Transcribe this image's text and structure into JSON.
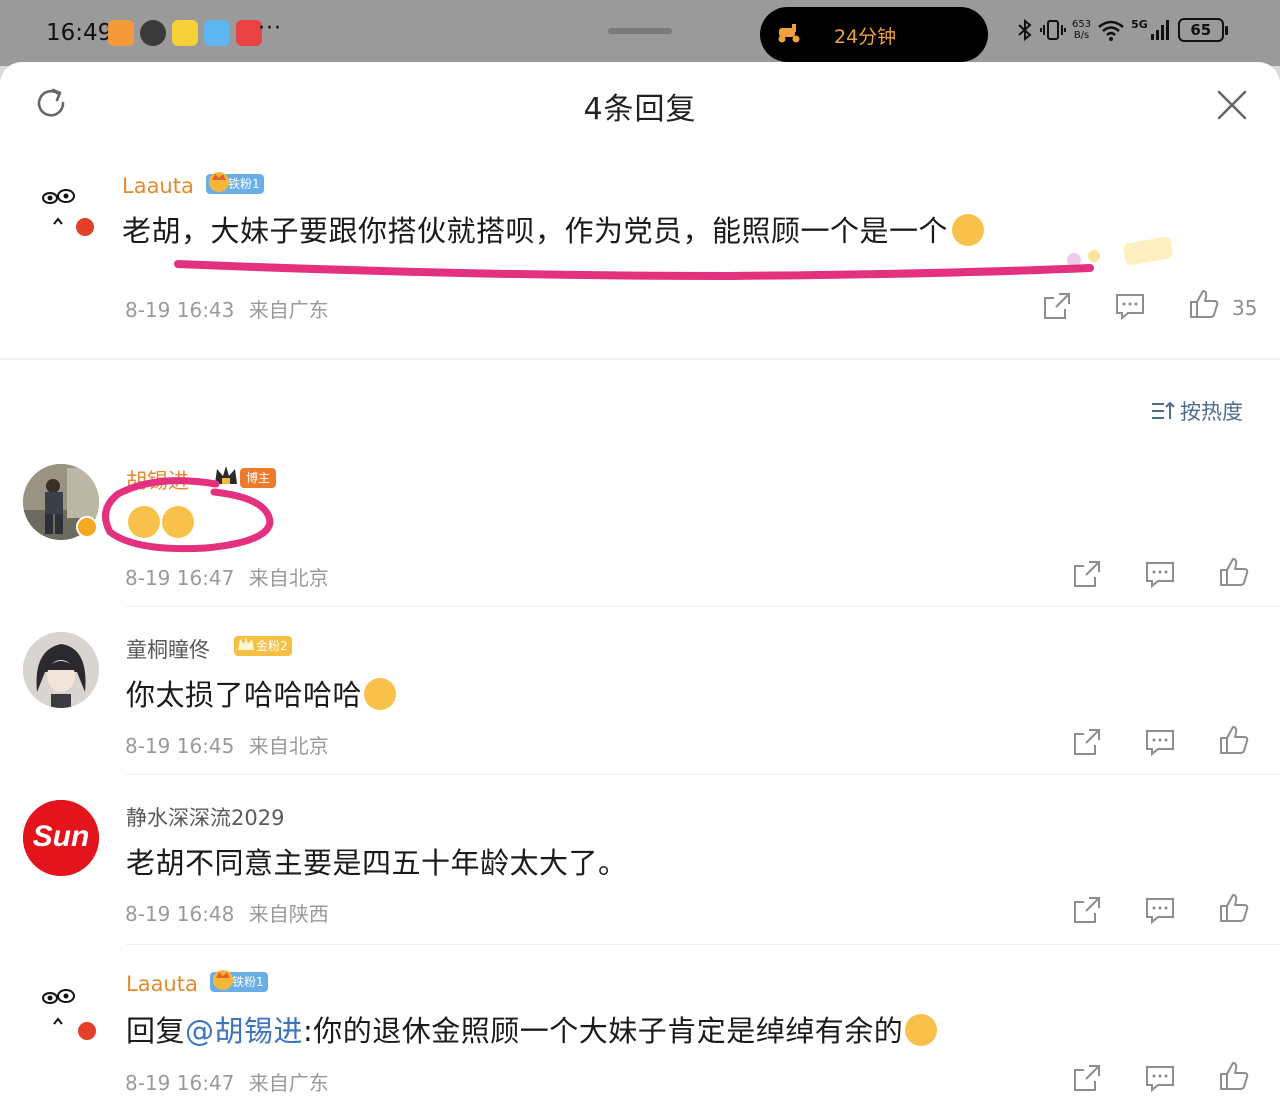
{
  "status_bar": {
    "time": "16:49",
    "dots": "···",
    "island_text": "24分钟",
    "net_speed_value": "653",
    "net_speed_unit": "B/s",
    "network": "5G",
    "battery": "65"
  },
  "sheet": {
    "title": "4条回复"
  },
  "root_comment": {
    "user": "Laauta",
    "fan_badge": "铁粉1",
    "text": "老胡，大妹子要跟你搭伙就搭呗，作为党员，能照顾一个是一个",
    "time": "8-19 16:43",
    "location": "来自广东",
    "likes": "35"
  },
  "sort": {
    "label": "按热度"
  },
  "replies": [
    {
      "user": "胡锡进",
      "badge": "博主",
      "text": "",
      "time": "8-19 16:47",
      "location": "来自北京"
    },
    {
      "user": "童桐瞳佟",
      "badge": "金粉2",
      "text": "你太损了哈哈哈哈",
      "time": "8-19 16:45",
      "location": "来自北京"
    },
    {
      "user": "静水深深流2029",
      "badge": "",
      "text": "老胡不同意主要是四五十年龄太大了。",
      "time": "8-19 16:48",
      "location": "来自陕西"
    },
    {
      "user": "Laauta",
      "badge": "铁粉1",
      "reply_prefix": "回复",
      "mention": "@胡锡进",
      "text": ":你的退休金照顾一个大妹子肯定是绰绰有余的",
      "time": "8-19 16:47",
      "location": "来自广东"
    }
  ],
  "avatar_logo_text": "Sun",
  "colors": {
    "accent_orange": "#e58a2d",
    "link_blue": "#3d74bf",
    "annotation_pink": "#e3307f"
  }
}
